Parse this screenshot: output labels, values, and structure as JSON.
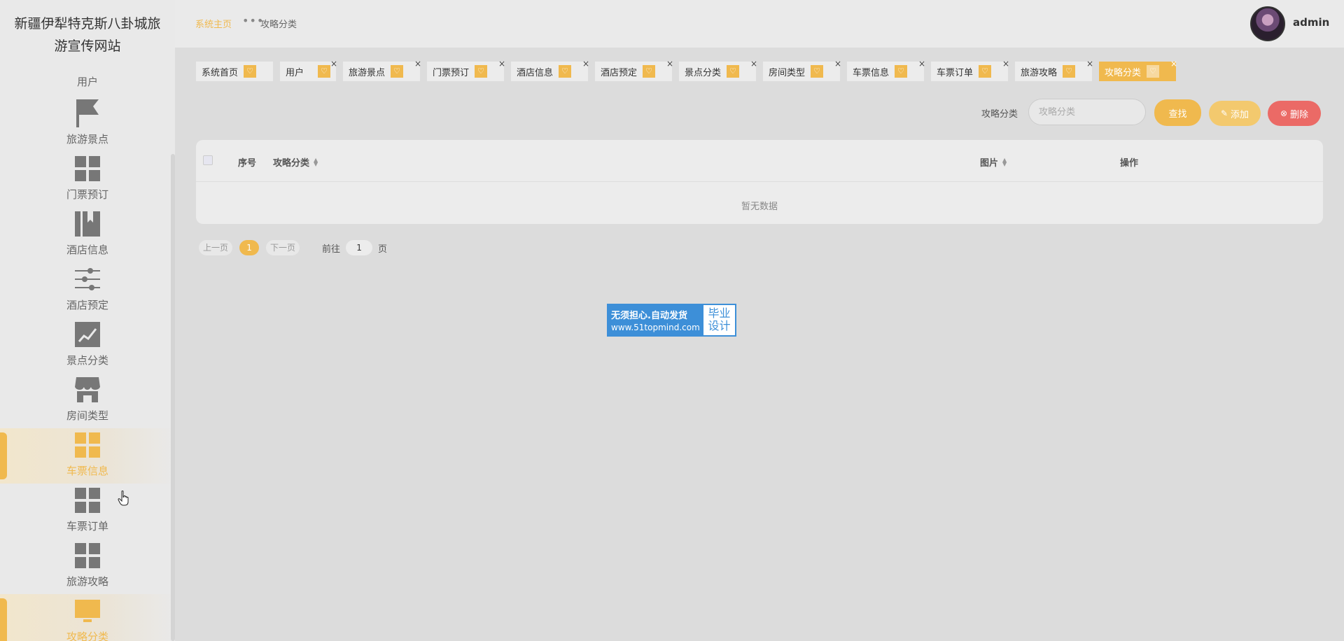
{
  "sidebar": {
    "site_title_line1": "新疆伊犁特克斯八卦城旅",
    "site_title_line2": "游宣传网站",
    "top_label": "用户",
    "items": [
      {
        "label": "旅游景点",
        "icon": "flag-icon",
        "active": false
      },
      {
        "label": "门票预订",
        "icon": "grid-icon",
        "active": false
      },
      {
        "label": "酒店信息",
        "icon": "bookmark-icon",
        "active": false
      },
      {
        "label": "酒店预定",
        "icon": "sliders-icon",
        "active": false
      },
      {
        "label": "景点分类",
        "icon": "chart-icon",
        "active": false
      },
      {
        "label": "房间类型",
        "icon": "store-icon",
        "active": false
      },
      {
        "label": "车票信息",
        "icon": "grid-icon",
        "active": true
      },
      {
        "label": "车票订单",
        "icon": "grid-icon",
        "active": false
      },
      {
        "label": "旅游攻略",
        "icon": "grid-icon",
        "active": false
      },
      {
        "label": "攻略分类",
        "icon": "monitor-icon",
        "active": true
      }
    ]
  },
  "header": {
    "breadcrumb_home": "系统主页",
    "breadcrumb_sep": "•••",
    "breadcrumb_current": "攻略分类",
    "username": "admin"
  },
  "tabs": [
    {
      "label": "系统首页",
      "closable": false,
      "active": false
    },
    {
      "label": "用户",
      "closable": true,
      "active": false
    },
    {
      "label": "旅游景点",
      "closable": true,
      "active": false
    },
    {
      "label": "门票预订",
      "closable": true,
      "active": false
    },
    {
      "label": "酒店信息",
      "closable": true,
      "active": false
    },
    {
      "label": "酒店预定",
      "closable": true,
      "active": false
    },
    {
      "label": "景点分类",
      "closable": true,
      "active": false
    },
    {
      "label": "房间类型",
      "closable": true,
      "active": false
    },
    {
      "label": "车票信息",
      "closable": true,
      "active": false
    },
    {
      "label": "车票订单",
      "closable": true,
      "active": false
    },
    {
      "label": "旅游攻略",
      "closable": true,
      "active": false
    },
    {
      "label": "攻略分类",
      "closable": true,
      "active": true
    }
  ],
  "tab_icon_glyph": "♡",
  "tab_close_glyph": "×",
  "filter": {
    "label": "攻略分类",
    "placeholder": "攻略分类",
    "value": "",
    "search_label": "查找",
    "add_label": "添加",
    "delete_label": "删除"
  },
  "table": {
    "columns": {
      "index": "序号",
      "category": "攻略分类",
      "image": "图片",
      "actions": "操作"
    },
    "empty_text": "暂无数据"
  },
  "pager": {
    "prev_label": "上一页",
    "current_page": "1",
    "next_label": "下一页",
    "goto_label": "前往",
    "goto_value": "1",
    "page_suffix": "页"
  },
  "watermark": {
    "line1": "无须担心.自动发货",
    "line2": "www.51topmind.com",
    "right1": "毕业",
    "right2": "设计"
  },
  "colors": {
    "accent": "#f0b94e",
    "danger": "#eb6a66",
    "icon_gray": "#777777"
  }
}
